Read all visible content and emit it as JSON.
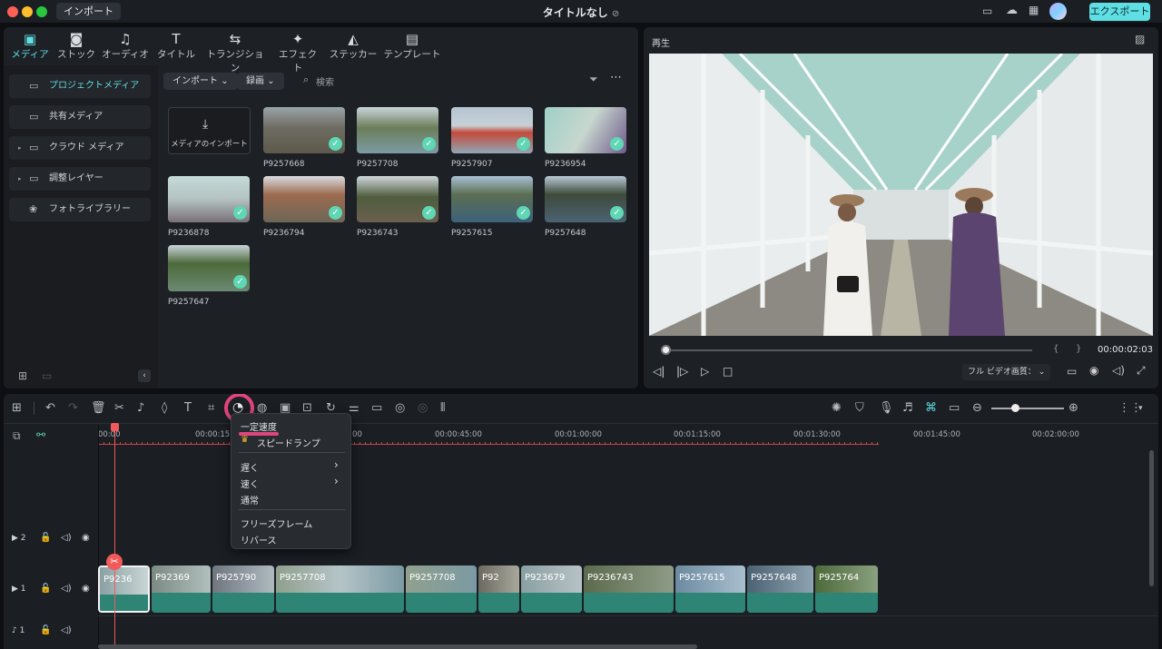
{
  "titlebar": {
    "import_label": "インポート",
    "title": "タイトルなし",
    "export_label": "エクスポート"
  },
  "media_tabs": [
    {
      "label": "メディア",
      "icon": "media-icon"
    },
    {
      "label": "ストック",
      "icon": "stock-icon"
    },
    {
      "label": "オーディオ",
      "icon": "music-note-icon"
    },
    {
      "label": "タイトル",
      "icon": "title-t-icon"
    },
    {
      "label": "トランジション",
      "icon": "transition-icon"
    },
    {
      "label": "エフェクト",
      "icon": "effect-sparkle-icon"
    },
    {
      "label": "ステッカー",
      "icon": "sticker-icon"
    },
    {
      "label": "テンプレート",
      "icon": "template-icon"
    }
  ],
  "sidebar": {
    "items": [
      {
        "label": "プロジェクトメディア",
        "active": true
      },
      {
        "label": "共有メディア"
      },
      {
        "label": "クラウド メディア"
      },
      {
        "label": "調整レイヤー"
      },
      {
        "label": "フォトライブラリー"
      }
    ]
  },
  "media_toolbar": {
    "import_dropdown": "インポート",
    "record_dropdown": "録画",
    "search_placeholder": "検索"
  },
  "media_items": {
    "import_tile_label": "メディアのインポート",
    "clips": [
      "P9257668",
      "P9257708",
      "P9257907",
      "P9236954",
      "P9236878",
      "P9236794",
      "P9236743",
      "P9257615",
      "P9257648",
      "P9257647"
    ]
  },
  "preview": {
    "label": "再生",
    "timecode": "00:00:02:03",
    "quality": "フル ビデオ画質："
  },
  "ruler": {
    "labels": [
      "00:00",
      "00:00:15:00",
      "00:00:30:00",
      "00:00:45:00",
      "00:01:00:00",
      "00:01:15:00",
      "00:01:30:00",
      "00:01:45:00",
      "00:02:00:00"
    ]
  },
  "tracks": {
    "video2": "2",
    "video1": "1",
    "audio1": "1"
  },
  "timeline_clips": [
    "P9236",
    "P92369",
    "P925790",
    "P9257708",
    "P9257708",
    "P92",
    "P923679",
    "P9236743",
    "P9257615",
    "P9257648",
    "P925764"
  ],
  "context_menu": {
    "items": [
      {
        "label": "一定速度"
      },
      {
        "label": "スピードランプ"
      },
      {
        "label": "遅く",
        "submenu": true
      },
      {
        "label": "速く",
        "submenu": true
      },
      {
        "label": "通常"
      },
      {
        "label": "フリーズフレーム"
      },
      {
        "label": "リバース"
      }
    ],
    "submenu_arrow": "›"
  },
  "colors": {
    "accent": "#5fdfe3",
    "highlight_ring": "#e0457b",
    "clip_green": "#2e8576",
    "playhead": "#f05a5a"
  }
}
